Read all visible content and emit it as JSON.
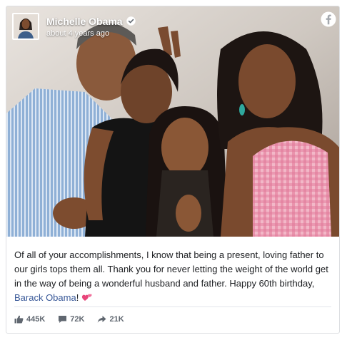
{
  "post": {
    "author": "Michelle Obama",
    "timestamp": "about 4 years ago",
    "text_main": "Of all of your accomplishments, I know that being a present, loving father to our girls tops them all. Thank you for never letting the weight of the world get in the way of being a wonderful husband and father. Happy 60th birthday, ",
    "mention": "Barack Obama",
    "text_tail": "!",
    "verified_icon": "verified-badge-icon",
    "platform_icon": "facebook-logo-icon",
    "emoji": "two-hearts-emoji"
  },
  "stats": {
    "likes": "445K",
    "comments": "72K",
    "shares": "21K"
  },
  "colors": {
    "link": "#385898",
    "text": "#1c1e21",
    "muted": "#606770",
    "heart": "#e8457a"
  }
}
